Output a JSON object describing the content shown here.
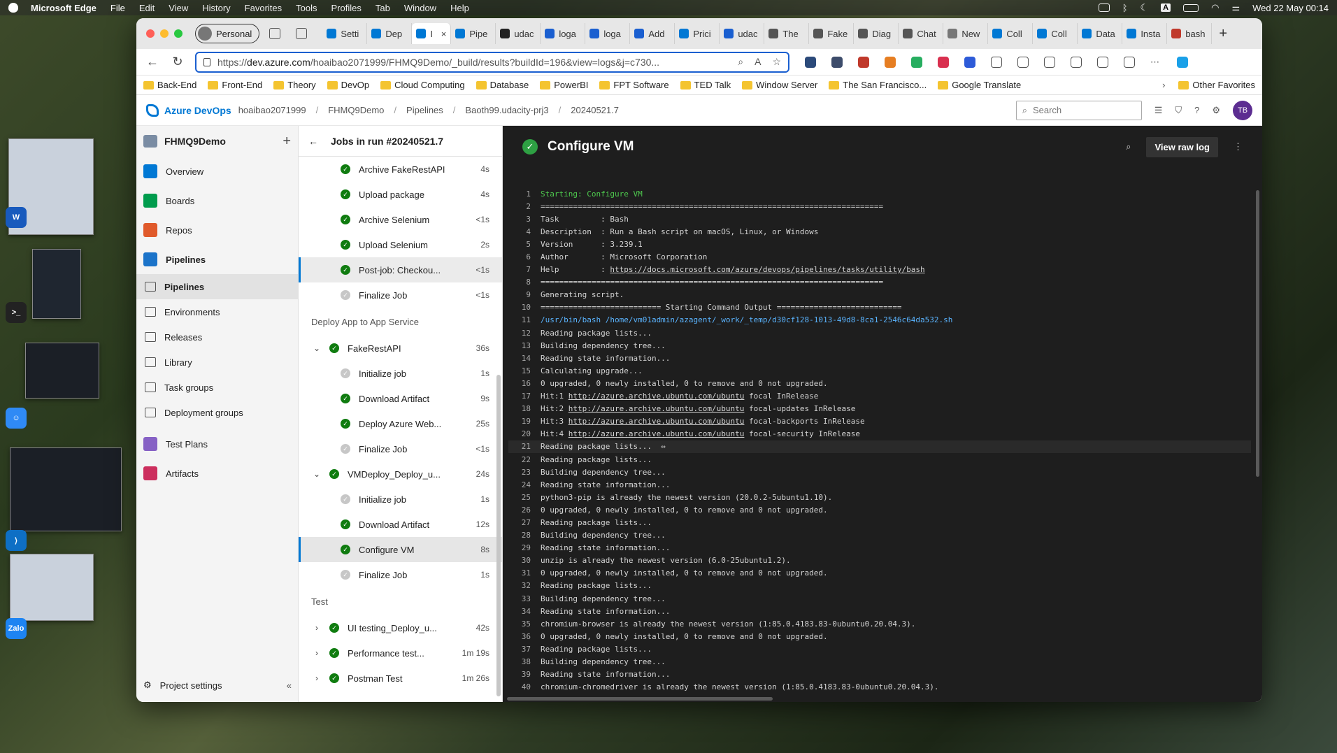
{
  "menubar": {
    "app": "Microsoft Edge",
    "items": [
      "File",
      "Edit",
      "View",
      "History",
      "Favorites",
      "Tools",
      "Profiles",
      "Tab",
      "Window",
      "Help"
    ],
    "clock": "Wed 22 May  00:14"
  },
  "browser": {
    "profile": "Personal",
    "tabs": [
      {
        "label": "Setti",
        "color": "#0078d4"
      },
      {
        "label": "Dep",
        "color": "#0078d4"
      },
      {
        "label": "I",
        "color": "#0078d4",
        "active": true
      },
      {
        "label": "Pipe",
        "color": "#0078d4"
      },
      {
        "label": "udac",
        "color": "#222222"
      },
      {
        "label": "loga",
        "color": "#1a5fd0"
      },
      {
        "label": "loga",
        "color": "#1a5fd0"
      },
      {
        "label": "Add",
        "color": "#1a5fd0"
      },
      {
        "label": "Prici",
        "color": "#0078d4"
      },
      {
        "label": "udac",
        "color": "#1a5fd0"
      },
      {
        "label": "The",
        "color": "#555555"
      },
      {
        "label": "Fake",
        "color": "#555555"
      },
      {
        "label": "Diag",
        "color": "#555555"
      },
      {
        "label": "Chat",
        "color": "#555555"
      },
      {
        "label": "New",
        "color": "#777777"
      },
      {
        "label": "Coll",
        "color": "#0078d4"
      },
      {
        "label": "Coll",
        "color": "#0078d4"
      },
      {
        "label": "Data",
        "color": "#0078d4"
      },
      {
        "label": "Insta",
        "color": "#0078d4"
      },
      {
        "label": "bash",
        "color": "#c0392b"
      }
    ],
    "url_prefix": "https://",
    "url_host": "dev.azure.com",
    "url_path": "/hoaibao2071999/FHMQ9Demo/_build/results?buildId=196&view=logs&j=c730...",
    "favorites": [
      "Back-End",
      "Front-End",
      "Theory",
      "DevOp",
      "Cloud Computing",
      "Database",
      "PowerBI",
      "FPT Software",
      "TED Talk",
      "Window Server",
      "The San Francisco...",
      "Google Translate"
    ],
    "other_favorites": "Other Favorites"
  },
  "ado": {
    "brand": "Azure DevOps",
    "breadcrumb": [
      "hoaibao2071999",
      "FHMQ9Demo",
      "Pipelines",
      "Baoth99.udacity-prj3",
      "20240521.7"
    ],
    "search_placeholder": "Search",
    "user_initials": "TB",
    "project": "FHMQ9Demo",
    "nav": [
      {
        "label": "Overview",
        "color": "#0078d4"
      },
      {
        "label": "Boards",
        "color": "#009c4d"
      },
      {
        "label": "Repos",
        "color": "#e05a2b"
      }
    ],
    "nav_pipelines": "Pipelines",
    "nav_sub": [
      "Pipelines",
      "Environments",
      "Releases",
      "Library",
      "Task groups",
      "Deployment groups"
    ],
    "nav_after": [
      {
        "label": "Test Plans",
        "color": "#8661c5"
      },
      {
        "label": "Artifacts",
        "color": "#cc2e5d"
      }
    ],
    "project_settings": "Project settings"
  },
  "jobs": {
    "title": "Jobs in run #20240521.7",
    "rows": [
      {
        "kind": "step",
        "name": "Archive FakeRestAPI",
        "dur": "4s",
        "status": "ok"
      },
      {
        "kind": "step",
        "name": "Upload package",
        "dur": "4s",
        "status": "ok"
      },
      {
        "kind": "step",
        "name": "Archive Selenium",
        "dur": "<1s",
        "status": "ok"
      },
      {
        "kind": "step",
        "name": "Upload Selenium",
        "dur": "2s",
        "status": "ok"
      },
      {
        "kind": "step",
        "name": "Post-job: Checkou...",
        "dur": "<1s",
        "status": "ok",
        "state": "active"
      },
      {
        "kind": "step",
        "name": "Finalize Job",
        "dur": "<1s",
        "status": "gray"
      },
      {
        "kind": "stage",
        "name": "Deploy App to App Service"
      },
      {
        "kind": "job",
        "name": "FakeRestAPI",
        "dur": "36s",
        "status": "ok",
        "chev": "expanded"
      },
      {
        "kind": "step",
        "name": "Initialize job",
        "dur": "1s",
        "status": "gray"
      },
      {
        "kind": "step",
        "name": "Download Artifact",
        "dur": "9s",
        "status": "ok"
      },
      {
        "kind": "step",
        "name": "Deploy Azure Web...",
        "dur": "25s",
        "status": "ok"
      },
      {
        "kind": "step",
        "name": "Finalize Job",
        "dur": "<1s",
        "status": "gray"
      },
      {
        "kind": "job",
        "name": "VMDeploy_Deploy_u...",
        "dur": "24s",
        "status": "ok",
        "chev": "expanded"
      },
      {
        "kind": "step",
        "name": "Initialize job",
        "dur": "1s",
        "status": "gray"
      },
      {
        "kind": "step",
        "name": "Download Artifact",
        "dur": "12s",
        "status": "ok"
      },
      {
        "kind": "step",
        "name": "Configure VM",
        "dur": "8s",
        "status": "ok",
        "state": "selected"
      },
      {
        "kind": "step",
        "name": "Finalize Job",
        "dur": "1s",
        "status": "gray"
      },
      {
        "kind": "stage",
        "name": "Test"
      },
      {
        "kind": "job",
        "name": "UI testing_Deploy_u...",
        "dur": "42s",
        "status": "ok",
        "chev": "collapsed"
      },
      {
        "kind": "job",
        "name": "Performance test...",
        "dur": "1m 19s",
        "status": "ok",
        "chev": "collapsed"
      },
      {
        "kind": "job",
        "name": "Postman Test",
        "dur": "1m 26s",
        "status": "ok",
        "chev": "collapsed"
      }
    ]
  },
  "log": {
    "title": "Configure VM",
    "raw_button": "View raw log",
    "lines": [
      {
        "t": "Starting: Configure VM",
        "c": "green"
      },
      {
        "t": "=========================================================================="
      },
      {
        "t": "Task         : Bash"
      },
      {
        "t": "Description  : Run a Bash script on macOS, Linux, or Windows"
      },
      {
        "t": "Version      : 3.239.1"
      },
      {
        "t": "Author       : Microsoft Corporation"
      },
      {
        "t": "Help         : ",
        "link": "https://docs.microsoft.com/azure/devops/pipelines/tasks/utility/bash"
      },
      {
        "t": "=========================================================================="
      },
      {
        "t": "Generating script."
      },
      {
        "t": "========================== Starting Command Output ==========================="
      },
      {
        "t": "/usr/bin/bash /home/vm01admin/azagent/_work/_temp/d30cf128-1013-49d8-8ca1-2546c64da532.sh",
        "c": "blue"
      },
      {
        "t": "Reading package lists..."
      },
      {
        "t": "Building dependency tree..."
      },
      {
        "t": "Reading state information..."
      },
      {
        "t": "Calculating upgrade..."
      },
      {
        "t": "0 upgraded, 0 newly installed, 0 to remove and 0 not upgraded."
      },
      {
        "t": "Hit:1 ",
        "link": "http://azure.archive.ubuntu.com/ubuntu",
        "after": " focal InRelease"
      },
      {
        "t": "Hit:2 ",
        "link": "http://azure.archive.ubuntu.com/ubuntu",
        "after": " focal-updates InRelease"
      },
      {
        "t": "Hit:3 ",
        "link": "http://azure.archive.ubuntu.com/ubuntu",
        "after": " focal-backports InRelease"
      },
      {
        "t": "Hit:4 ",
        "link": "http://azure.archive.ubuntu.com/ubuntu",
        "after": " focal-security InRelease"
      },
      {
        "t": "Reading package lists...  ⇔",
        "hl": true
      },
      {
        "t": "Reading package lists..."
      },
      {
        "t": "Building dependency tree..."
      },
      {
        "t": "Reading state information..."
      },
      {
        "t": "python3-pip is already the newest version (20.0.2-5ubuntu1.10)."
      },
      {
        "t": "0 upgraded, 0 newly installed, 0 to remove and 0 not upgraded."
      },
      {
        "t": "Reading package lists..."
      },
      {
        "t": "Building dependency tree..."
      },
      {
        "t": "Reading state information..."
      },
      {
        "t": "unzip is already the newest version (6.0-25ubuntu1.2)."
      },
      {
        "t": "0 upgraded, 0 newly installed, 0 to remove and 0 not upgraded."
      },
      {
        "t": "Reading package lists..."
      },
      {
        "t": "Building dependency tree..."
      },
      {
        "t": "Reading state information..."
      },
      {
        "t": "chromium-browser is already the newest version (1:85.0.4183.83-0ubuntu0.20.04.3)."
      },
      {
        "t": "0 upgraded, 0 newly installed, 0 to remove and 0 not upgraded."
      },
      {
        "t": "Reading package lists..."
      },
      {
        "t": "Building dependency tree..."
      },
      {
        "t": "Reading state information..."
      },
      {
        "t": "chromium-chromedriver is already the newest version (1:85.0.4183.83-0ubuntu0.20.04.3)."
      }
    ]
  }
}
